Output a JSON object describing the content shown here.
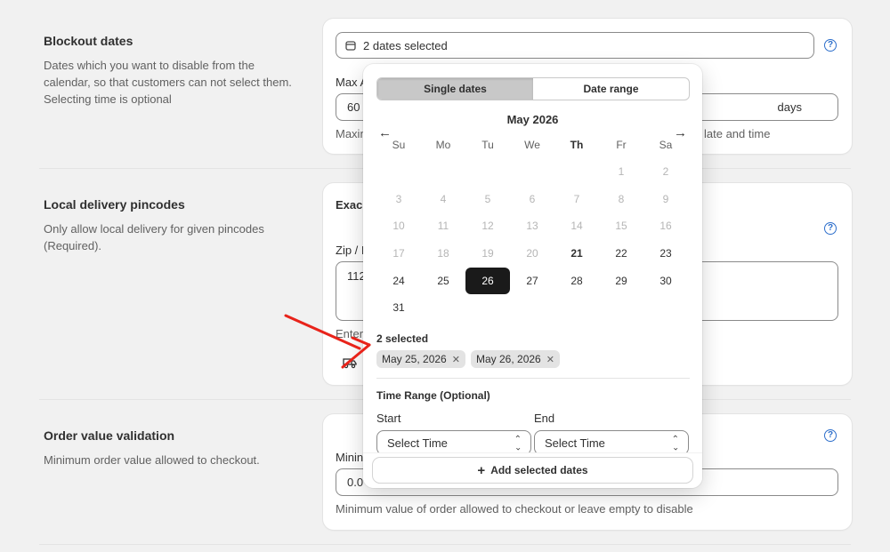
{
  "blockout": {
    "title": "Blockout dates",
    "desc": "Dates which you want to disable from the calendar, so that customers can not select them. Selecting time is optional",
    "field_value": "2 dates selected",
    "max_label": "Max A",
    "max_value": "60",
    "max_suffix": "days",
    "hint_left": "Maxin",
    "hint_right": "late and time"
  },
  "pincode": {
    "title": "Local delivery pincodes",
    "desc": "Only allow local delivery for given pincodes (Required).",
    "exact_label": "Exac",
    "zip_label": "Zip / I",
    "zip_value": "112",
    "hint": "Enter"
  },
  "order": {
    "title": "Order value validation",
    "desc": "Minimum order value allowed to checkout.",
    "min_label": "Minin",
    "min_value": "0.0",
    "hint": "Minimum value of order allowed to checkout or leave empty to disable"
  },
  "picker": {
    "tabs": [
      "Single dates",
      "Date range"
    ],
    "month_title": "May 2026",
    "weekdays": [
      "Su",
      "Mo",
      "Tu",
      "We",
      "Th",
      "Fr",
      "Sa"
    ],
    "days_disabled": [
      "1",
      "2",
      "3",
      "4",
      "5",
      "6",
      "7",
      "8",
      "9",
      "10",
      "11",
      "12",
      "13",
      "14",
      "15",
      "16",
      "17",
      "18",
      "19",
      "20"
    ],
    "days_enabled": [
      "21",
      "22",
      "23",
      "24",
      "25",
      "26",
      "27",
      "28",
      "29",
      "30",
      "31"
    ],
    "today": "21",
    "selected_day": "26",
    "selected_count_label": "2 selected",
    "chips": [
      "May 25, 2026",
      "May 26, 2026"
    ],
    "time_range_title": "Time Range (Optional)",
    "start_label": "Start",
    "end_label": "End",
    "start_placeholder": "Select Time",
    "end_placeholder": "Select Time",
    "add_button": "Add selected dates"
  },
  "colors": {
    "accent_blue": "#2c6ecb",
    "selected_day_bg": "#1a1a1a",
    "annotation_arrow": "#e8231a"
  }
}
